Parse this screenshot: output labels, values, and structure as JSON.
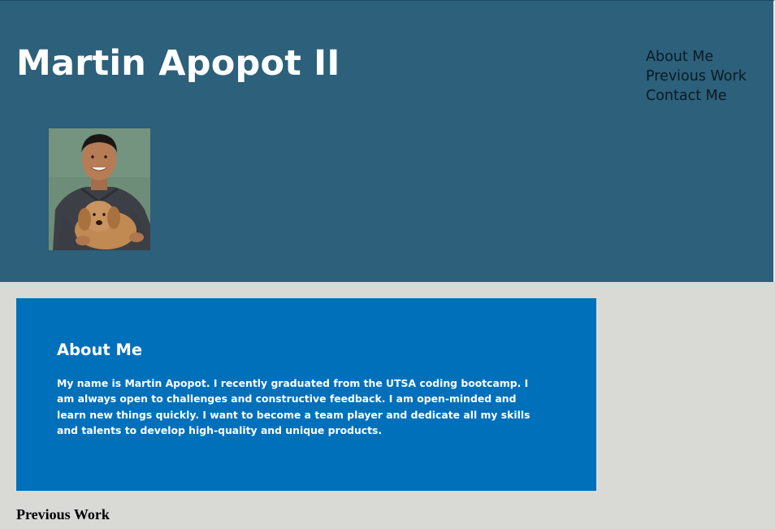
{
  "header": {
    "title": "Martin Apopot II",
    "nav": [
      {
        "label": "About Me"
      },
      {
        "label": "Previous Work"
      },
      {
        "label": "Contact Me"
      }
    ],
    "background_color": "#2c607b"
  },
  "profile_photo": {
    "subject": "man-holding-golden-puppy",
    "background_color": "#6e8d78"
  },
  "about": {
    "heading": "About Me",
    "body": "My name is Martin Apopot. I recently graduated from the UTSA coding bootcamp. I am always open to challenges and constructive feedback. I am open-minded and learn new things quickly. I want to become a team player and dedicate all my skills and talents to develop high-quality and unique products.",
    "background_color": "#0170bb"
  },
  "previous_work": {
    "heading": "Previous Work"
  },
  "page_background_color": "#d9dad6"
}
